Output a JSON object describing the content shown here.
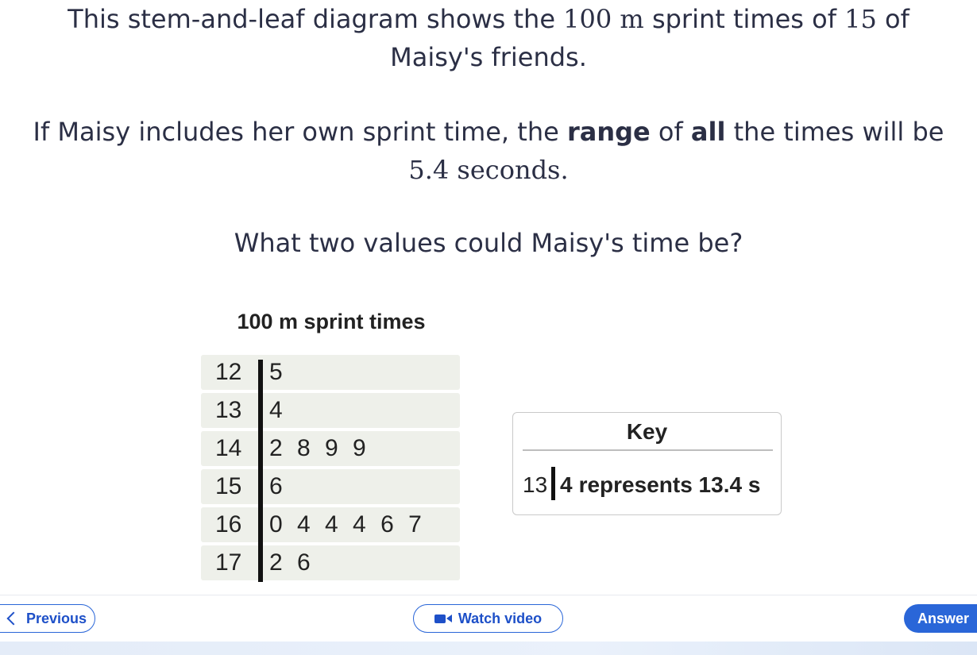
{
  "question": {
    "p1_a": "This stem-and-leaf diagram shows the ",
    "p1_m1": "100 m",
    "p1_b": " sprint times of ",
    "p1_m2": "15",
    "p1_c": " of",
    "p1_d": "Maisy's friends.",
    "p2_a": "If Maisy includes her own sprint time, the ",
    "p2_bold1": "range",
    "p2_b": " of ",
    "p2_bold2": "all",
    "p2_c": " the times will be",
    "p2_m": "5.4 seconds.",
    "p3": "What two values could Maisy's time be?"
  },
  "plot": {
    "title": "100 m sprint times",
    "rows": [
      {
        "stem": "12",
        "leaves": "5"
      },
      {
        "stem": "13",
        "leaves": "4"
      },
      {
        "stem": "14",
        "leaves": "2 8 9 9"
      },
      {
        "stem": "15",
        "leaves": "6"
      },
      {
        "stem": "16",
        "leaves": "0 4 4 4 6 7"
      },
      {
        "stem": "17",
        "leaves": "2 6"
      }
    ]
  },
  "key": {
    "title": "Key",
    "stem": "13",
    "leaf": "4",
    "text": "represents 13.4 s"
  },
  "nav": {
    "previous": "Previous",
    "video": "Watch video",
    "answer": "Answer"
  },
  "colors": {
    "accent": "#2a66d8",
    "text": "#2b2f45",
    "row_bg": "#eef0ea"
  }
}
